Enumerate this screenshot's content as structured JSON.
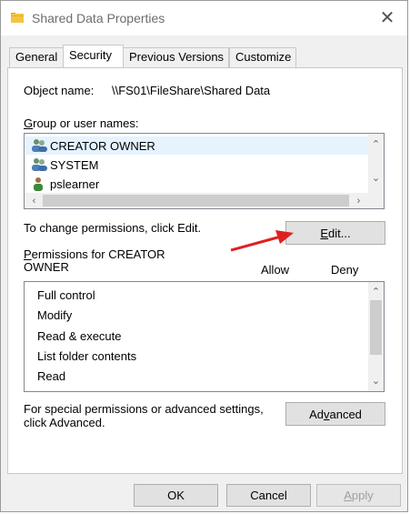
{
  "window": {
    "title": "Shared Data Properties"
  },
  "tabs": [
    {
      "label": "General",
      "active": false
    },
    {
      "label": "Security",
      "active": true
    },
    {
      "label": "Previous Versions",
      "active": false
    },
    {
      "label": "Customize",
      "active": false
    }
  ],
  "security": {
    "object_name_label": "Object name:",
    "object_name_value": "\\\\FS01\\FileShare\\Shared Data",
    "group_label_accel": "G",
    "group_label_rest": "roup or user names:",
    "users": [
      {
        "name": "CREATOR OWNER",
        "icon": "users-group-icon",
        "selected": true
      },
      {
        "name": "SYSTEM",
        "icon": "users-group-icon",
        "selected": false
      },
      {
        "name": "pslearner",
        "icon": "user-icon",
        "selected": false
      }
    ],
    "change_text": "To change permissions, click Edit.",
    "edit_accel": "E",
    "edit_rest": "dit...",
    "perm_label_accel": "P",
    "perm_label_rest": "ermissions for CREATOR",
    "perm_label_line2": "OWNER",
    "allow_header": "Allow",
    "deny_header": "Deny",
    "permissions": [
      "Full control",
      "Modify",
      "Read & execute",
      "List folder contents",
      "Read"
    ],
    "special_text_line1": "For special permissions or advanced settings,",
    "special_text_line2": "click Advanced.",
    "advanced_pre": "Ad",
    "advanced_accel": "v",
    "advanced_post": "anced"
  },
  "footer": {
    "ok": "OK",
    "cancel": "Cancel",
    "apply_accel": "A",
    "apply_rest": "pply"
  },
  "annotation": {
    "arrow_color": "#e02020"
  }
}
